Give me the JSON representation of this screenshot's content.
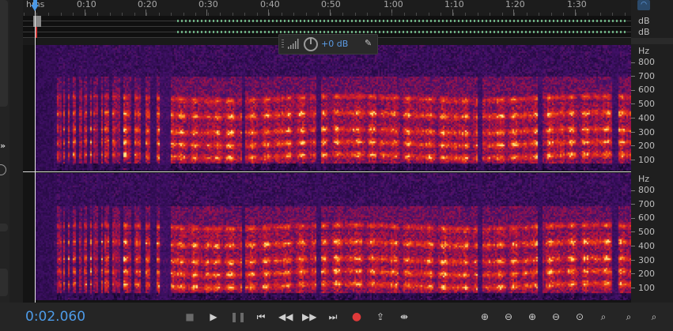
{
  "ruler": {
    "unit_label": "hms",
    "ticks": [
      "0:10",
      "0:20",
      "0:30",
      "0:40",
      "0:50",
      "1:00",
      "1:10",
      "1:20",
      "1:30"
    ]
  },
  "overview": {
    "db_labels": [
      "dB",
      "dB"
    ]
  },
  "hud": {
    "gain_value": "+0 dB"
  },
  "frequency_scale": {
    "unit": "Hz",
    "labels": [
      "800",
      "700",
      "600",
      "500",
      "400",
      "300",
      "200",
      "100"
    ]
  },
  "transport": {
    "timecode": "0:02.060",
    "buttons": [
      "stop-icon",
      "play-icon",
      "pause-icon",
      "skip-start-icon",
      "rewind-icon",
      "fast-forward-icon",
      "skip-end-icon",
      "record-icon",
      "loop-icon",
      "skip-selection-icon"
    ]
  },
  "zoom": {
    "buttons": [
      "zoom-in-amplitude-icon",
      "zoom-out-amplitude-icon",
      "zoom-in-icon",
      "zoom-out-icon",
      "zoom-full-icon",
      "zoom-in-selection-icon",
      "zoom-in-start-icon",
      "zoom-in-end-icon"
    ]
  },
  "colors": {
    "accent": "#4b98e6",
    "spectrum_low": "#2a0e4a",
    "spectrum_mid": "#d02418",
    "spectrum_high": "#ffd070",
    "record": "#e03a3a"
  }
}
